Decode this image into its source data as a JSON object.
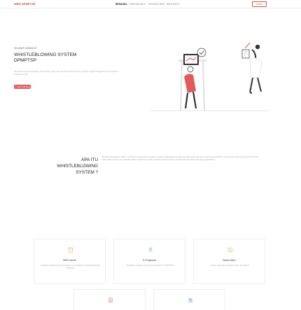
{
  "header": {
    "brand": "WBS DPMPTSP",
    "nav": [
      {
        "label": "BERANDA",
        "active": true
      },
      {
        "label": "PENGADUAN ▾",
        "active": false
      },
      {
        "label": "TENTANG WBS",
        "active": false
      },
      {
        "label": "BANTUAN ▾",
        "active": false
      }
    ],
    "login_label": "LOGIN"
  },
  "hero": {
    "greeting": "SELAMAT DATANG DI",
    "title_line1": "WHISTLEBLOWING SYSTEM",
    "title_line2": "DPMPTSP",
    "description": "Mari Bersama-Sama Wujudkan Pemerintahan Yang Jujur dan Bersih Dari Korupsi, Laporkan Segala Pelanggaran Yang Terjadi Di Lingkungan Kerja",
    "button_label": "✓ Lapor Sekarang"
  },
  "about": {
    "title_line1": "APA ITU",
    "title_line2": "WHISTLEBLOWING",
    "title_line3": "SYSTEM ?",
    "description": "Whistleblowing System adalah mekanisme penyampaian pengaduan dugaan tindak pidana korupsi yang telah terjadi atau akan terjadi yang melibatkan pegawai dan orang lain yang terkait dengan tindak pidana korupsi yang dilakukan dalam organisasi tempatnya bekerja, dimana pelapor memiliki bukti yang dapat dipertanggungjawabkan."
  },
  "cards": [
    {
      "icon": "building-icon",
      "title": "WBS Internal",
      "desc": "Pengaduan tindakan internal pelanggaran yang dilakukan oleh Pegawai/Pejabat DPMPTSP"
    },
    {
      "icon": "user-icon",
      "title": "E-Pengaduan",
      "desc": "Pengaduan pelayanan perizinan pada aplikasi Non SIAPDIOSE"
    },
    {
      "icon": "whatsapp-icon",
      "title": "Wadul Aladin",
      "desc": "layanan WhatsApp Pengaduan Online Jati Sulawesi"
    },
    {
      "icon": "document-icon",
      "title": "",
      "desc": ""
    },
    {
      "icon": "users-icon",
      "title": "",
      "desc": ""
    }
  ],
  "colors": {
    "accent": "#e05c5c",
    "brand": "#c0392b"
  }
}
